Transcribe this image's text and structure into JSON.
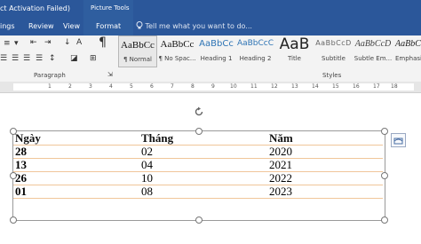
{
  "title_bar": {
    "doc_title": "ct Activation Failed)",
    "context_tab_group": "Picture Tools"
  },
  "tabs": [
    {
      "label": "ings",
      "x": 0
    },
    {
      "label": "Review",
      "x": 32
    },
    {
      "label": "View",
      "x": 71
    }
  ],
  "active_context_tab": "Format",
  "tell_me": "Tell me what you want to do...",
  "ribbon": {
    "paragraph_label": "Paragraph",
    "styles_label": "Styles"
  },
  "styles": [
    {
      "sample": "AaBbCc",
      "name": "¶ Normal",
      "selected": true
    },
    {
      "sample": "AaBbCc",
      "name": "¶ No Spac..."
    },
    {
      "sample": "AaBbCc",
      "name": "Heading 1"
    },
    {
      "sample": "AaBbCcC",
      "name": "Heading 2"
    },
    {
      "sample": "AaB",
      "name": "Title"
    },
    {
      "sample": "AaBbCcD",
      "name": "Subtitle"
    },
    {
      "sample": "AaBbCcD",
      "name": "Subtle Em..."
    },
    {
      "sample": "AaBbCcI",
      "name": "Emphasis"
    }
  ],
  "ruler_ticks": [
    "1",
    "2",
    "3",
    "4",
    "5",
    "6",
    "7",
    "8",
    "9",
    "10",
    "11",
    "12",
    "13",
    "14",
    "15",
    "16",
    "17",
    "18"
  ],
  "table": {
    "headers": [
      "Ngày",
      "Tháng",
      "Năm"
    ],
    "rows": [
      [
        "28",
        "02",
        "2020"
      ],
      [
        "13",
        "04",
        "2021"
      ],
      [
        "26",
        "10",
        "2022"
      ],
      [
        "01",
        "08",
        "2023"
      ]
    ]
  },
  "colors": {
    "ribbon_blue": "#2b579a",
    "row_border": "#f0c69a"
  }
}
